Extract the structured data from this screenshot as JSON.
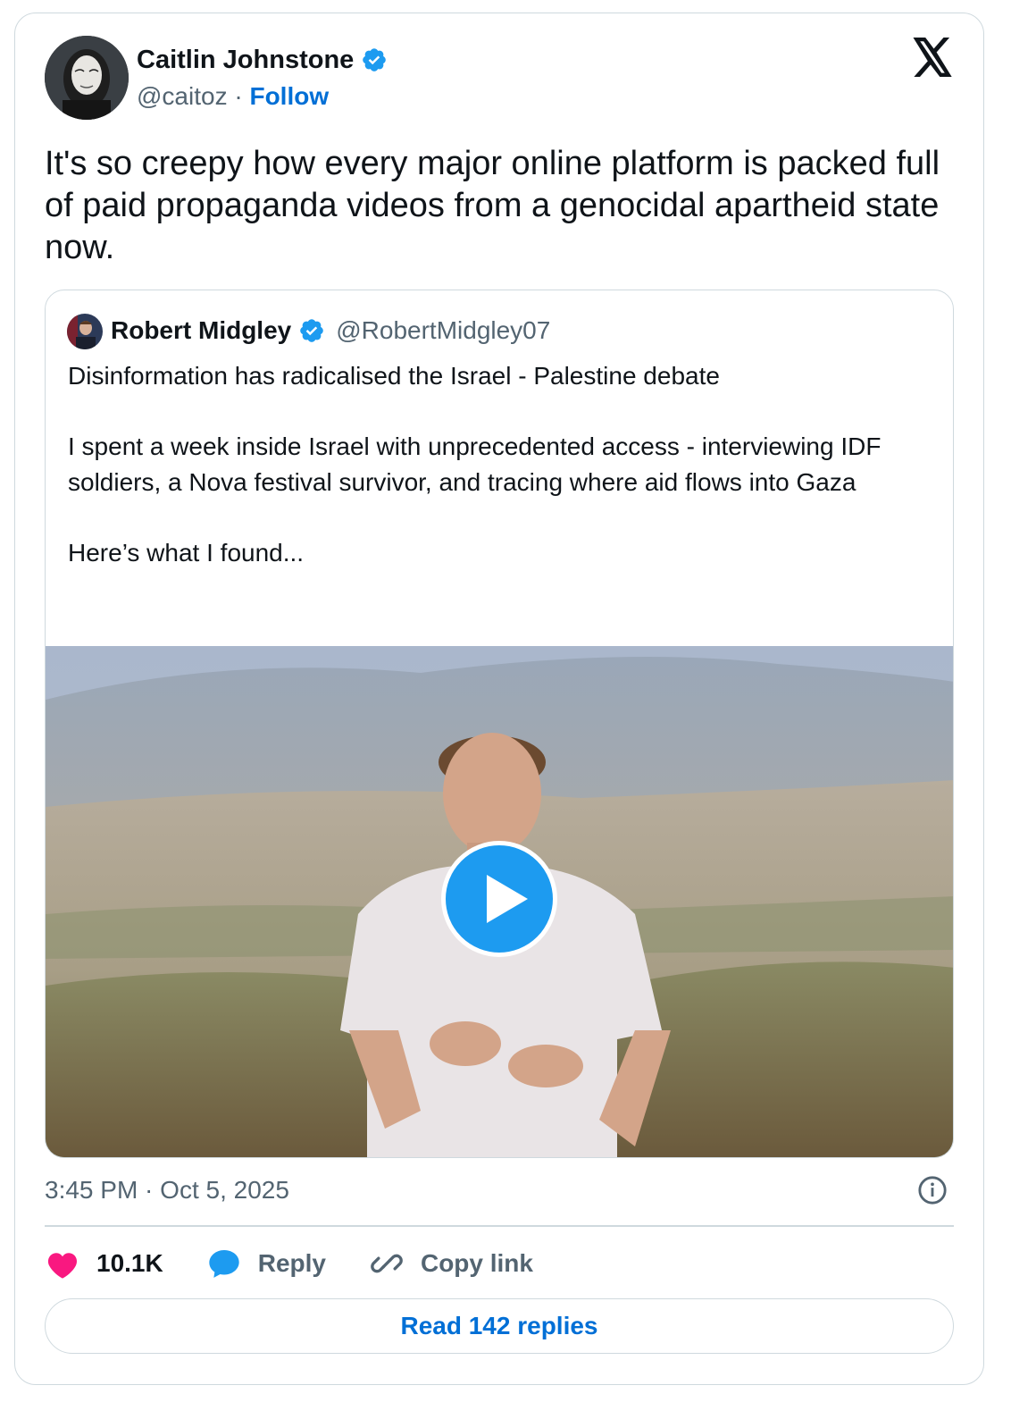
{
  "author": {
    "name": "Caitlin Johnstone",
    "handle": "@caitoz",
    "separator": "·",
    "follow_label": "Follow",
    "verified": true
  },
  "tweet": {
    "text": "It's so creepy how every major online platform is packed full of paid propaganda videos from a genocidal apartheid state now.",
    "timestamp": "3:45 PM · Oct 5, 2025"
  },
  "quoted": {
    "name": "Robert Midgley",
    "handle": "@RobertMidgley07",
    "verified": true,
    "paragraphs": [
      "Disinformation has radicalised the Israel - Palestine debate",
      "I spent a week inside Israel with unprecedented access - interviewing IDF soldiers, a Nova festival survivor, and tracing where aid flows into Gaza",
      "Here’s what I found..."
    ]
  },
  "actions": {
    "likes": "10.1K",
    "reply_label": "Reply",
    "copy_label": "Copy link"
  },
  "read_replies_label": "Read 142 replies",
  "icons": {
    "brand": "x-logo-icon",
    "verified": "verified-badge-icon",
    "like": "heart-icon",
    "reply": "speech-bubble-icon",
    "copy": "link-icon",
    "info": "info-icon",
    "play": "play-icon"
  },
  "colors": {
    "link_blue": "#006fd6",
    "verified_blue": "#1d9bf0",
    "like_pink": "#f91880",
    "muted": "#536471",
    "border": "#cfd9de"
  }
}
